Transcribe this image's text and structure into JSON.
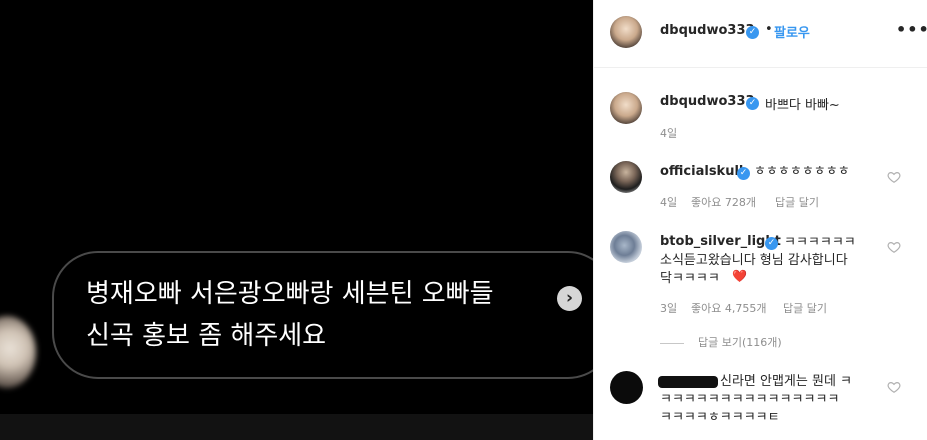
{
  "media": {
    "dm_message": "병재오빠 서은광오빠랑 세븐틴 오빠들\n신곡 홍보 좀 해주세요",
    "next_symbol": "›"
  },
  "header": {
    "username": "dbqudwo333",
    "dot": "•",
    "follow_label": "팔로우",
    "more_symbol": "•••"
  },
  "caption": {
    "username": "dbqudwo333",
    "text": "바쁘다 바빠~",
    "time": "4일"
  },
  "comments": [
    {
      "username": "officialskull",
      "text": "ㅎㅎㅎㅎㅎㅎㅎㅎ",
      "time": "4일",
      "likes": "좋아요 728개",
      "reply": "답글 달기"
    },
    {
      "username": "btob_silver_light",
      "text": "ㅋㅋㅋㅋㅋㅋ\n소식듣고왔습니다 형님 감사합니다\n닥ㅋㅋㅋㅋ",
      "emoji": "❤️",
      "time": "3일",
      "likes": "좋아요 4,755개",
      "reply": "답글 달기",
      "view_replies": "답글 보기(116개)"
    },
    {
      "text": "신라면 안맵게는 뭔데 ㅋ\nㅋㅋㅋㅋㅋㅋㅋㅋㅋㅋㅋㅋㅋㅋㅋ\nㅋㅋㅋㅋㅎㅋㅋㅋㅋㅌ"
    }
  ],
  "colors": {
    "accent": "#3897f0",
    "text": "#262626",
    "muted": "#8e8e8e",
    "heart_emoji": "#e0245e"
  }
}
